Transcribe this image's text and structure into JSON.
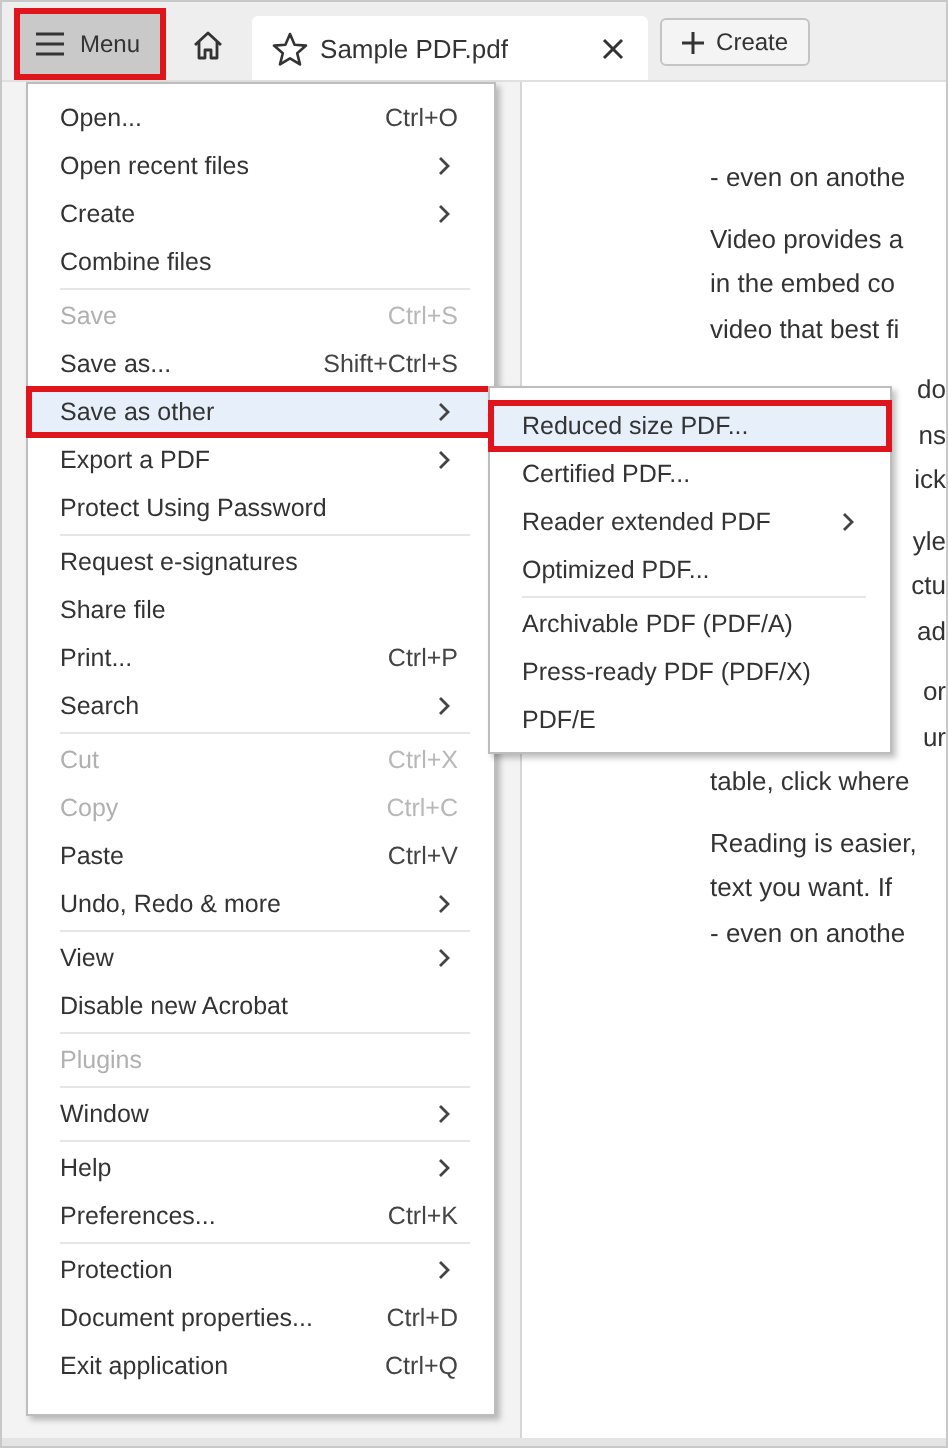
{
  "toolbar": {
    "menu_button": {
      "label": "Menu",
      "pressed": true
    },
    "tab": {
      "title": "Sample PDF.pdf"
    },
    "create_button": {
      "label": "Create"
    }
  },
  "document": {
    "paragraphs": [
      {
        "lines": [
          {
            "kind": "full",
            "text": "- even on anothe"
          }
        ]
      },
      {
        "lines": [
          {
            "kind": "full",
            "text": "Video provides a"
          },
          {
            "kind": "full",
            "text": "in the embed co"
          },
          {
            "kind": "full",
            "text": "video that best fi"
          }
        ]
      },
      {
        "lines": [
          {
            "kind": "tail",
            "text": "do"
          },
          {
            "kind": "tail",
            "text": "ns"
          },
          {
            "kind": "tail",
            "text": "ick"
          }
        ]
      },
      {
        "lines": [
          {
            "kind": "tail",
            "text": "yle"
          },
          {
            "kind": "tail",
            "text": "ctu"
          },
          {
            "kind": "tail",
            "text": "ad"
          }
        ]
      },
      {
        "lines": [
          {
            "kind": "tail",
            "text": "or"
          },
          {
            "kind": "tail",
            "text": "ur"
          },
          {
            "kind": "full",
            "text": "table, click where"
          }
        ]
      },
      {
        "lines": [
          {
            "kind": "full",
            "text": "Reading is easier,"
          },
          {
            "kind": "full",
            "text": "text you want. If"
          },
          {
            "kind": "full",
            "text": "- even on anothe"
          }
        ]
      }
    ]
  },
  "menu": {
    "groups": [
      {
        "items": [
          {
            "label": "Open...",
            "shortcut": "Ctrl+O",
            "submenu": false,
            "disabled": false,
            "selected": false
          },
          {
            "label": "Open recent files",
            "submenu": true,
            "disabled": false,
            "selected": false
          },
          {
            "label": "Create",
            "submenu": true,
            "disabled": false,
            "selected": false
          },
          {
            "label": "Combine files",
            "submenu": false,
            "disabled": false,
            "selected": false
          }
        ]
      },
      {
        "items": [
          {
            "label": "Save",
            "shortcut": "Ctrl+S",
            "submenu": false,
            "disabled": true,
            "selected": false
          },
          {
            "label": "Save as...",
            "shortcut": "Shift+Ctrl+S",
            "submenu": false,
            "disabled": false,
            "selected": false
          },
          {
            "label": "Save as other",
            "submenu": true,
            "disabled": false,
            "selected": true
          },
          {
            "label": "Export a PDF",
            "submenu": true,
            "disabled": false,
            "selected": false
          },
          {
            "label": "Protect Using Password",
            "submenu": false,
            "disabled": false,
            "selected": false
          }
        ]
      },
      {
        "items": [
          {
            "label": "Request e-signatures",
            "submenu": false,
            "disabled": false,
            "selected": false
          },
          {
            "label": "Share file",
            "submenu": false,
            "disabled": false,
            "selected": false
          },
          {
            "label": "Print...",
            "shortcut": "Ctrl+P",
            "submenu": false,
            "disabled": false,
            "selected": false
          },
          {
            "label": "Search",
            "submenu": true,
            "disabled": false,
            "selected": false
          }
        ]
      },
      {
        "items": [
          {
            "label": "Cut",
            "shortcut": "Ctrl+X",
            "submenu": false,
            "disabled": true,
            "selected": false
          },
          {
            "label": "Copy",
            "shortcut": "Ctrl+C",
            "submenu": false,
            "disabled": true,
            "selected": false
          },
          {
            "label": "Paste",
            "shortcut": "Ctrl+V",
            "submenu": false,
            "disabled": false,
            "selected": false
          },
          {
            "label": "Undo, Redo & more",
            "submenu": true,
            "disabled": false,
            "selected": false
          }
        ]
      },
      {
        "items": [
          {
            "label": "View",
            "submenu": true,
            "disabled": false,
            "selected": false
          },
          {
            "label": "Disable new Acrobat",
            "submenu": false,
            "disabled": false,
            "selected": false
          }
        ]
      },
      {
        "items": [
          {
            "label": "Plugins",
            "submenu": false,
            "disabled": true,
            "selected": false
          }
        ]
      },
      {
        "items": [
          {
            "label": "Window",
            "submenu": true,
            "disabled": false,
            "selected": false
          }
        ]
      },
      {
        "items": [
          {
            "label": "Help",
            "submenu": true,
            "disabled": false,
            "selected": false
          },
          {
            "label": "Preferences...",
            "shortcut": "Ctrl+K",
            "submenu": false,
            "disabled": false,
            "selected": false
          }
        ]
      },
      {
        "items": [
          {
            "label": "Protection",
            "submenu": true,
            "disabled": false,
            "selected": false
          },
          {
            "label": "Document properties...",
            "shortcut": "Ctrl+D",
            "submenu": false,
            "disabled": false,
            "selected": false
          },
          {
            "label": "Exit application",
            "shortcut": "Ctrl+Q",
            "submenu": false,
            "disabled": false,
            "selected": false
          }
        ]
      }
    ]
  },
  "submenu": {
    "groups": [
      {
        "items": [
          {
            "label": "Reduced size PDF...",
            "submenu": false,
            "disabled": false,
            "selected": true
          },
          {
            "label": "Certified PDF...",
            "submenu": false,
            "disabled": false,
            "selected": false
          },
          {
            "label": "Reader extended PDF",
            "submenu": true,
            "disabled": false,
            "selected": false
          },
          {
            "label": "Optimized PDF...",
            "submenu": false,
            "disabled": false,
            "selected": false
          }
        ]
      },
      {
        "items": [
          {
            "label": "Archivable PDF (PDF/A)",
            "submenu": false,
            "disabled": false,
            "selected": false
          },
          {
            "label": "Press-ready PDF (PDF/X)",
            "submenu": false,
            "disabled": false,
            "selected": false
          },
          {
            "label": "PDF/E",
            "submenu": false,
            "disabled": false,
            "selected": false
          }
        ]
      }
    ]
  }
}
